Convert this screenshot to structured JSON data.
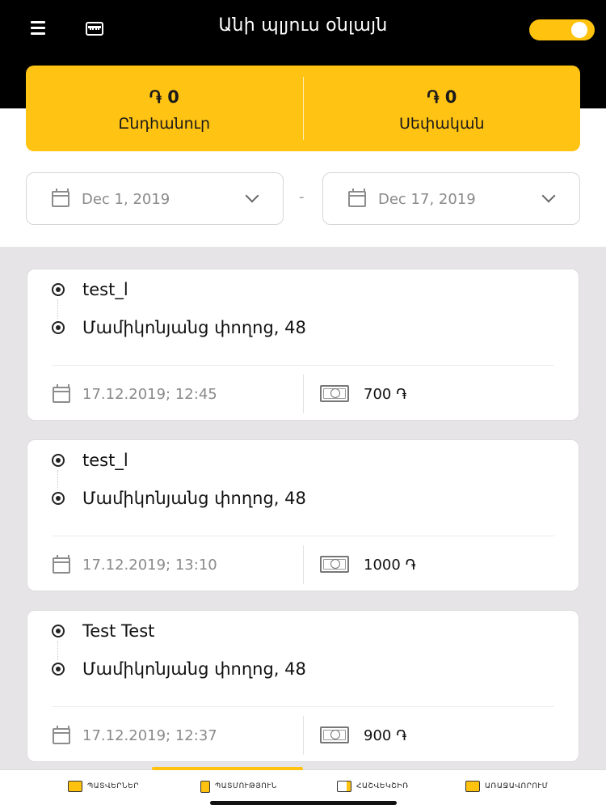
{
  "header": {
    "title": "Անի պլյուս օնլայն",
    "menu_icon": "hamburger-menu-icon",
    "wallet_icon": "wallet-icon",
    "toggle_state": "on",
    "accent_color": "#ffc20e"
  },
  "balance": {
    "total_value": "֏ 0",
    "total_label": "Ընդհանուր",
    "own_value": "֏ 0",
    "own_label": "Սեփական"
  },
  "date_range": {
    "from": "Dec 1, 2019",
    "separator": "-",
    "to": "Dec 17, 2019"
  },
  "orders": [
    {
      "from": "test_l",
      "to": "Մամիկոնյանց փողոց, 48",
      "datetime": "17.12.2019; 12:45",
      "price": "700 ֏"
    },
    {
      "from": "test_l",
      "to": "Մամիկոնյանց փողոց, 48",
      "datetime": "17.12.2019; 13:10",
      "price": "1000 ֏"
    },
    {
      "from": "Test Test",
      "to": "Մամիկոնյանց փողոց, 48",
      "datetime": "17.12.2019; 12:37",
      "price": "900 ֏"
    }
  ],
  "bottom_nav": [
    {
      "label": "ՊԱՏՎԵՐՆԵՐ",
      "icon": "taxi-icon",
      "active": false
    },
    {
      "label": "ՊԱՏՄՈՒԹՅՈՒՆ",
      "icon": "history-document-icon",
      "active": true
    },
    {
      "label": "ՀԱՇՎԵԿՇԻՌ",
      "icon": "wallet-icon",
      "active": false
    },
    {
      "label": "ԱՌԱՋԱՎՈՐՈՒՄ",
      "icon": "promotion-bag-icon",
      "active": false
    }
  ]
}
